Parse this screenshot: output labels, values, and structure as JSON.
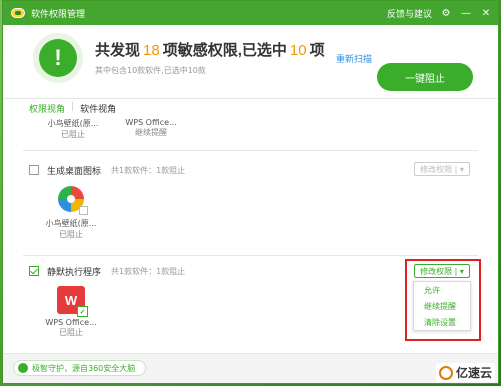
{
  "titlebar": {
    "title": "软件权限管理",
    "feedback": "反馈与建议",
    "settings_icon": "gear-icon",
    "minimize": "—",
    "close": "✕"
  },
  "header": {
    "headline_prefix": "共发现",
    "found_count": "18",
    "headline_middle": "项敏感权限,已选中",
    "selected_count": "10",
    "headline_suffix": "项",
    "subline": "其中包含10款软件,已选中10款",
    "rescan_label": "重新扫描",
    "oneclick_label": "一键阻止",
    "status_icon": "exclamation-shield-icon",
    "status_glyph": "!"
  },
  "tabs": {
    "permission_view": "权限视角",
    "software_view": "软件视角"
  },
  "top_apps": [
    {
      "name": "小鸟壁纸(原...",
      "status": "已阻止"
    },
    {
      "name": "WPS Office...",
      "status": "继续提醒"
    }
  ],
  "groups": [
    {
      "title": "生成桌面图标",
      "meta": "共1款软件：1款阻止",
      "modify_label": "修改权限 | ▾",
      "checked": false,
      "app": {
        "name": "小鸟壁纸(原...",
        "status": "已阻止"
      }
    },
    {
      "title": "静默执行程序",
      "meta": "共1款软件：1款阻止",
      "modify_label": "修改权限 | ▾",
      "checked": true,
      "app": {
        "name": "WPS Office...",
        "status": "已阻止"
      }
    }
  ],
  "dropdown": {
    "options": [
      "允许",
      "继续提醒",
      "清除设置"
    ]
  },
  "footer": {
    "guard_text": "极智守护，源自360安全大脑"
  },
  "watermark": {
    "text": "亿速云"
  },
  "colors": {
    "accent": "#3aae2a",
    "orange": "#f39800",
    "link": "#2f8ee0",
    "highlight": "#e02020"
  }
}
